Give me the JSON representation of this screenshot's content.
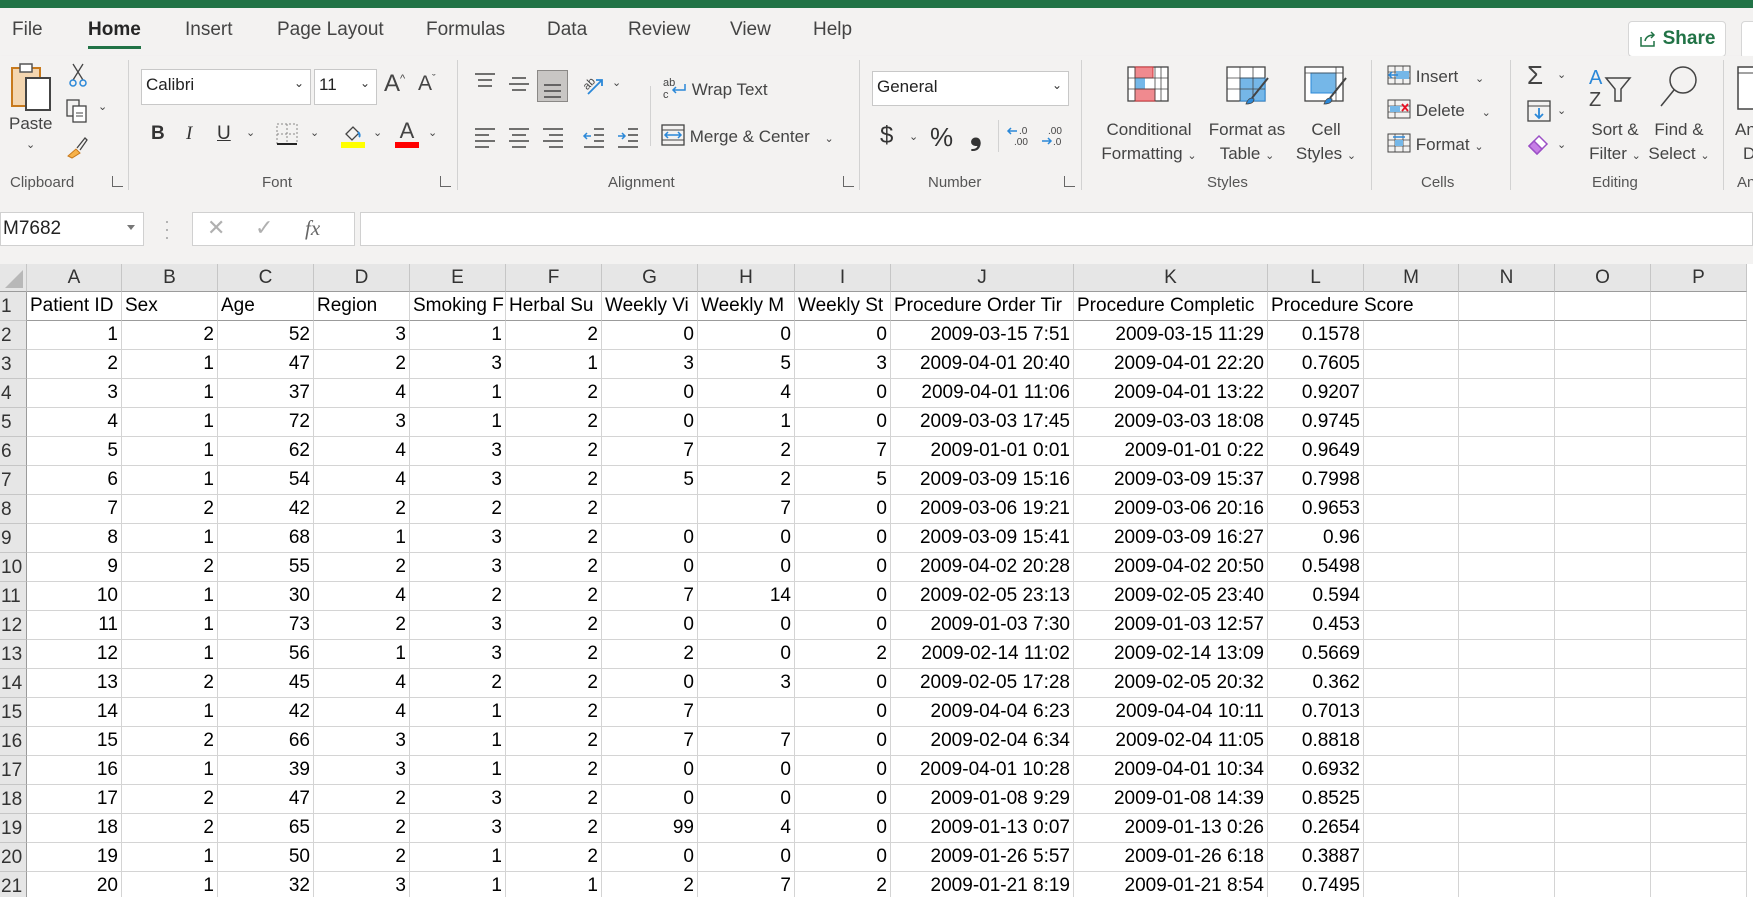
{
  "app": {
    "accent": "#217346"
  },
  "tabs": [
    {
      "label": "File",
      "active": false
    },
    {
      "label": "Home",
      "active": true
    },
    {
      "label": "Insert",
      "active": false
    },
    {
      "label": "Page Layout",
      "active": false
    },
    {
      "label": "Formulas",
      "active": false
    },
    {
      "label": "Data",
      "active": false
    },
    {
      "label": "Review",
      "active": false
    },
    {
      "label": "View",
      "active": false
    },
    {
      "label": "Help",
      "active": false
    }
  ],
  "share_label": "Share",
  "ribbon": {
    "clipboard": {
      "label": "Clipboard",
      "paste": "Paste"
    },
    "font": {
      "label": "Font",
      "font_name": "Calibri",
      "font_size": "11",
      "bold": "B",
      "italic": "I",
      "underline": "U",
      "font_color_letter": "A",
      "grow": "A",
      "shrink": "A"
    },
    "alignment": {
      "label": "Alignment",
      "wrap_text": "Wrap Text",
      "merge_center": "Merge & Center"
    },
    "number": {
      "label": "Number",
      "format": "General",
      "currency": "$",
      "percent": "%",
      "comma": "❟"
    },
    "styles": {
      "label": "Styles",
      "conditional_1": "Conditional",
      "conditional_2": "Formatting",
      "format_table_1": "Format as",
      "format_table_2": "Table",
      "cell_styles_1": "Cell",
      "cell_styles_2": "Styles"
    },
    "cells": {
      "label": "Cells",
      "insert": "Insert",
      "delete": "Delete",
      "format": "Format"
    },
    "editing": {
      "label": "Editing",
      "sort_1": "Sort &",
      "sort_2": "Filter",
      "find_1": "Find &",
      "find_2": "Select"
    },
    "analyze": {
      "label_1": "An",
      "label_2": "D",
      "group": "An"
    }
  },
  "formula_bar": {
    "name_box": "M7682",
    "fx": "fx",
    "formula": ""
  },
  "sheet": {
    "columns": [
      "A",
      "B",
      "C",
      "D",
      "E",
      "F",
      "G",
      "H",
      "I",
      "J",
      "K",
      "L",
      "M",
      "N",
      "O",
      "P"
    ],
    "row_numbers": [
      "1",
      "2",
      "3",
      "4",
      "5",
      "6",
      "7",
      "8",
      "9",
      "10",
      "11",
      "12",
      "13",
      "14",
      "15",
      "16",
      "17",
      "18",
      "19",
      "20",
      "21"
    ],
    "headers": [
      "Patient ID",
      "Sex",
      "Age",
      "Region",
      "Smoking F",
      "Herbal Su",
      "Weekly Vi",
      "Weekly M",
      "Weekly St",
      "Procedure Order Tir",
      "Procedure Completic",
      "Procedure Score"
    ],
    "rows": [
      [
        "1",
        "2",
        "52",
        "3",
        "1",
        "2",
        "0",
        "0",
        "0",
        "2009-03-15 7:51",
        "2009-03-15 11:29",
        "0.1578"
      ],
      [
        "2",
        "1",
        "47",
        "2",
        "3",
        "1",
        "3",
        "5",
        "3",
        "2009-04-01 20:40",
        "2009-04-01 22:20",
        "0.7605"
      ],
      [
        "3",
        "1",
        "37",
        "4",
        "1",
        "2",
        "0",
        "4",
        "0",
        "2009-04-01 11:06",
        "2009-04-01 13:22",
        "0.9207"
      ],
      [
        "4",
        "1",
        "72",
        "3",
        "1",
        "2",
        "0",
        "1",
        "0",
        "2009-03-03 17:45",
        "2009-03-03 18:08",
        "0.9745"
      ],
      [
        "5",
        "1",
        "62",
        "4",
        "3",
        "2",
        "7",
        "2",
        "7",
        "2009-01-01 0:01",
        "2009-01-01 0:22",
        "0.9649"
      ],
      [
        "6",
        "1",
        "54",
        "4",
        "3",
        "2",
        "5",
        "2",
        "5",
        "2009-03-09 15:16",
        "2009-03-09 15:37",
        "0.7998"
      ],
      [
        "7",
        "2",
        "42",
        "2",
        "2",
        "2",
        "",
        "7",
        "0",
        "2009-03-06 19:21",
        "2009-03-06 20:16",
        "0.9653"
      ],
      [
        "8",
        "1",
        "68",
        "1",
        "3",
        "2",
        "0",
        "0",
        "0",
        "2009-03-09 15:41",
        "2009-03-09 16:27",
        "0.96"
      ],
      [
        "9",
        "2",
        "55",
        "2",
        "3",
        "2",
        "0",
        "0",
        "0",
        "2009-04-02 20:28",
        "2009-04-02 20:50",
        "0.5498"
      ],
      [
        "10",
        "1",
        "30",
        "4",
        "2",
        "2",
        "7",
        "14",
        "0",
        "2009-02-05 23:13",
        "2009-02-05 23:40",
        "0.594"
      ],
      [
        "11",
        "1",
        "73",
        "2",
        "3",
        "2",
        "0",
        "0",
        "0",
        "2009-01-03 7:30",
        "2009-01-03 12:57",
        "0.453"
      ],
      [
        "12",
        "1",
        "56",
        "1",
        "3",
        "2",
        "2",
        "0",
        "2",
        "2009-02-14 11:02",
        "2009-02-14 13:09",
        "0.5669"
      ],
      [
        "13",
        "2",
        "45",
        "4",
        "2",
        "2",
        "0",
        "3",
        "0",
        "2009-02-05 17:28",
        "2009-02-05 20:32",
        "0.362"
      ],
      [
        "14",
        "1",
        "42",
        "4",
        "1",
        "2",
        "7",
        "",
        "0",
        "2009-04-04 6:23",
        "2009-04-04 10:11",
        "0.7013"
      ],
      [
        "15",
        "2",
        "66",
        "3",
        "1",
        "2",
        "7",
        "7",
        "0",
        "2009-02-04 6:34",
        "2009-02-04 11:05",
        "0.8818"
      ],
      [
        "16",
        "1",
        "39",
        "3",
        "1",
        "2",
        "0",
        "0",
        "0",
        "2009-04-01 10:28",
        "2009-04-01 10:34",
        "0.6932"
      ],
      [
        "17",
        "2",
        "47",
        "2",
        "3",
        "2",
        "0",
        "0",
        "0",
        "2009-01-08 9:29",
        "2009-01-08 14:39",
        "0.8525"
      ],
      [
        "18",
        "2",
        "65",
        "2",
        "3",
        "2",
        "99",
        "4",
        "0",
        "2009-01-13 0:07",
        "2009-01-13 0:26",
        "0.2654"
      ],
      [
        "19",
        "1",
        "50",
        "2",
        "1",
        "2",
        "0",
        "0",
        "0",
        "2009-01-26 5:57",
        "2009-01-26 6:18",
        "0.3887"
      ],
      [
        "20",
        "1",
        "32",
        "3",
        "1",
        "1",
        "2",
        "7",
        "2",
        "2009-01-21 8:19",
        "2009-01-21 8:54",
        "0.7495"
      ]
    ]
  }
}
